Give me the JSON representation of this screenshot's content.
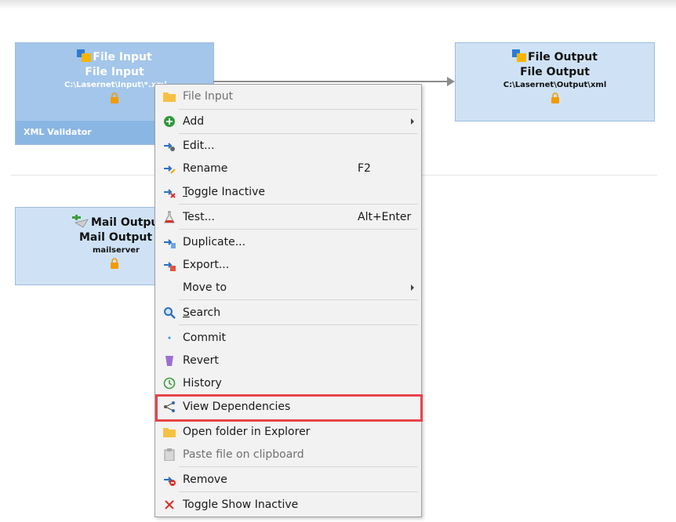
{
  "canvas": {
    "file_input_node": {
      "title1": "File Input",
      "title2": "File Input",
      "path": "C:\\Lasernet\\Input\\*.xml"
    },
    "xml_validator": {
      "label": "XML Validator"
    },
    "file_output_node": {
      "title1": "File Output",
      "title2": "File Output",
      "path": "C:\\Lasernet\\Output\\xml"
    },
    "mail_output_node": {
      "title1": "Mail Output",
      "title2": "Mail Output",
      "path": "mailserver"
    }
  },
  "menu": {
    "header": "File Input",
    "add": "Add",
    "edit": "Edit...",
    "rename": "Rename",
    "rename_shortcut": "F2",
    "toggle_inactive": "Toggle Inactive",
    "test": "Test...",
    "test_shortcut": "Alt+Enter",
    "duplicate": "Duplicate...",
    "export": "Export...",
    "move_to": "Move to",
    "search": "Search",
    "commit": "Commit",
    "revert": "Revert",
    "history": "History",
    "view_dependencies": "View Dependencies",
    "open_folder": "Open folder in Explorer",
    "paste_file": "Paste file on clipboard",
    "remove": "Remove",
    "toggle_show_inactive": "Toggle Show Inactive"
  },
  "colors": {
    "highlight": "#e8434a",
    "node_blue": "#b6d2ee",
    "node_selected": "#8ab6e3"
  }
}
